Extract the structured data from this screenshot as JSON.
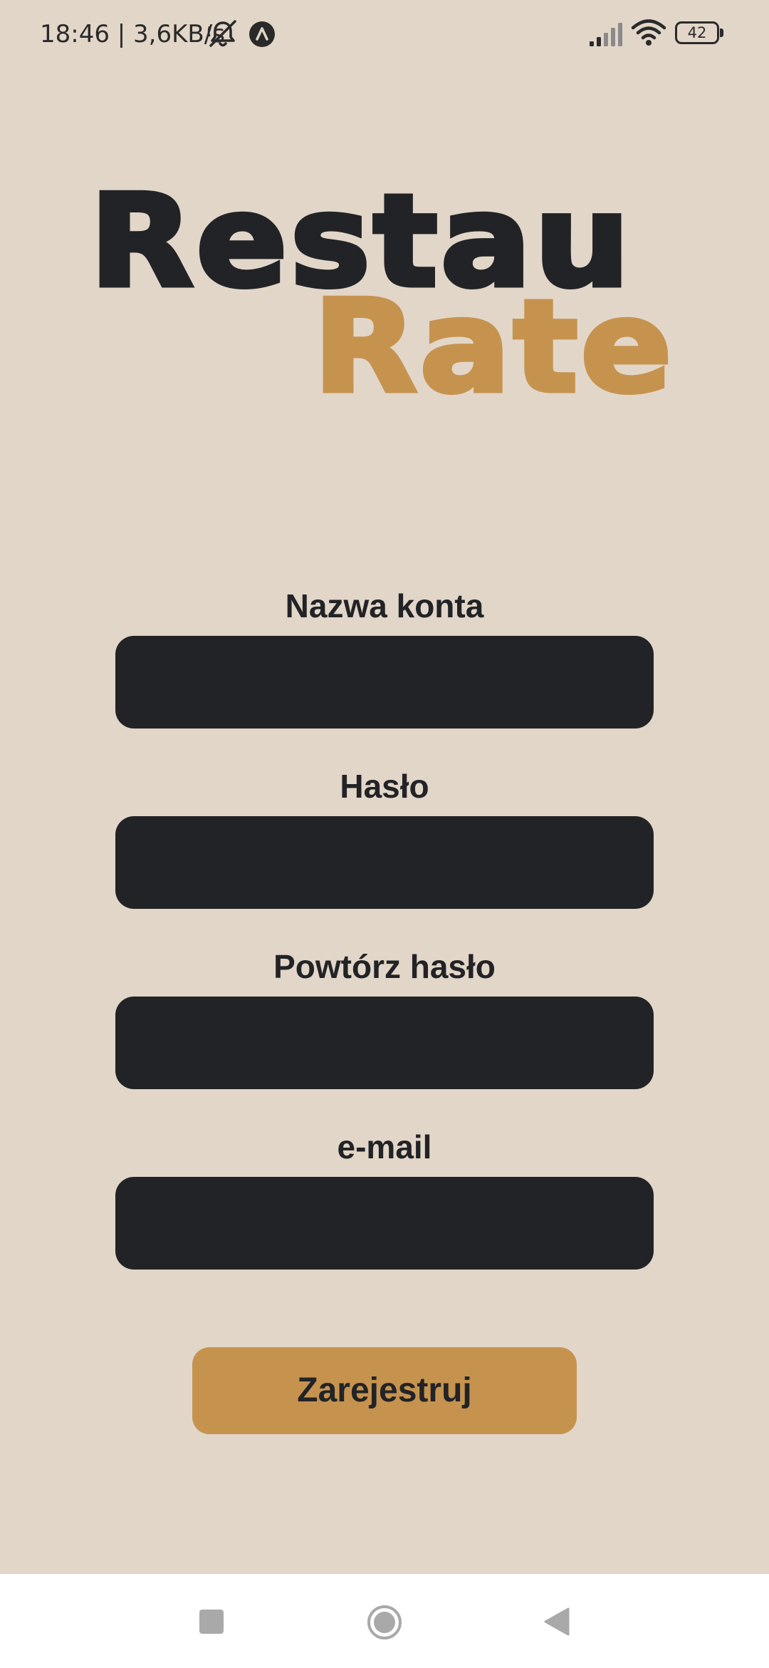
{
  "status_bar": {
    "time_and_speed": "18:46 | 3,6KB/s",
    "battery_level": "42",
    "icons": [
      "mute-icon",
      "navigation-app-icon",
      "signal-icon",
      "wifi-icon",
      "battery-icon"
    ]
  },
  "logo": {
    "line1": "Restau",
    "line2": "Rate"
  },
  "form": {
    "username": {
      "label": "Nazwa konta",
      "value": ""
    },
    "password": {
      "label": "Hasło",
      "value": ""
    },
    "password_repeat": {
      "label": "Powtórz hasło",
      "value": ""
    },
    "email": {
      "label": "e-mail",
      "value": ""
    }
  },
  "register_button": {
    "label": "Zarejestruj"
  },
  "nav_bar": {
    "icons": [
      "recents-icon",
      "home-icon",
      "back-icon"
    ]
  },
  "colors": {
    "background": "#e2d6c9",
    "dark": "#222326",
    "accent": "#c6934f",
    "nav_bar": "#ffffff"
  }
}
